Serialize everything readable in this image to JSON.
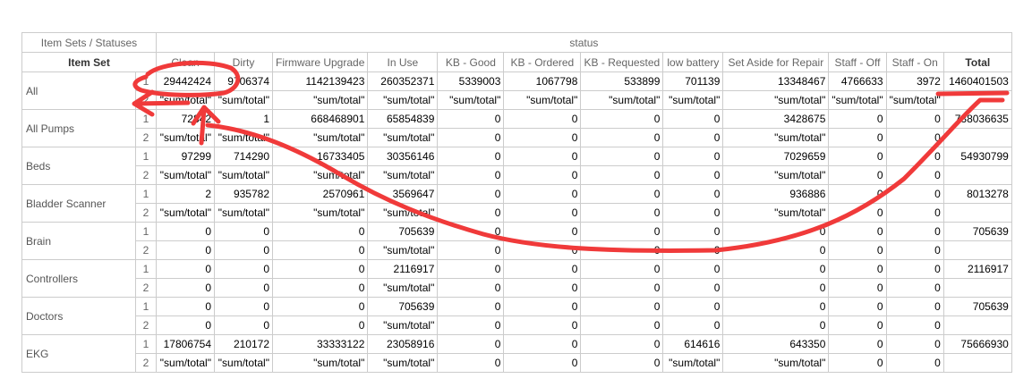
{
  "header": {
    "corner_label": "Item Sets / Statuses",
    "status_group_label": "status",
    "row_header_label": "Item Set",
    "columns": [
      "Clean",
      "Dirty",
      "Firmware Upgrade",
      "In Use",
      "KB - Good",
      "KB - Ordered",
      "KB - Requested",
      "low battery",
      "Set Aside for Repair",
      "Staff - Off",
      "Staff - On",
      "Total"
    ]
  },
  "rows": [
    {
      "name": "All",
      "r1": [
        "29442424",
        "9706374",
        "1142139423",
        "260352371",
        "5339003",
        "1067798",
        "533899",
        "701139",
        "13348467",
        "4766633",
        "3972",
        "1460401503"
      ],
      "r2": [
        "\"sum/total\"",
        "\"sum/total\"",
        "\"sum/total\"",
        "\"sum/total\"",
        "\"sum/total\"",
        "\"sum/total\"",
        "\"sum/total\"",
        "\"sum/total\"",
        "\"sum/total\"",
        "\"sum/total\"",
        "\"sum/total\"",
        ""
      ]
    },
    {
      "name": "All Pumps",
      "r1": [
        "72842",
        "1",
        "668468901",
        "65854839",
        "0",
        "0",
        "0",
        "0",
        "3428675",
        "0",
        "0",
        "738036635"
      ],
      "r2": [
        "\"sum/total\"",
        "\"sum/total\"",
        "\"sum/total\"",
        "\"sum/total\"",
        "0",
        "0",
        "0",
        "0",
        "\"sum/total\"",
        "0",
        "0",
        ""
      ]
    },
    {
      "name": "Beds",
      "r1": [
        "97299",
        "714290",
        "16733405",
        "30356146",
        "0",
        "0",
        "0",
        "0",
        "7029659",
        "0",
        "0",
        "54930799"
      ],
      "r2": [
        "\"sum/total\"",
        "\"sum/total\"",
        "\"sum/total\"",
        "\"sum/total\"",
        "0",
        "0",
        "0",
        "0",
        "\"sum/total\"",
        "0",
        "0",
        ""
      ]
    },
    {
      "name": "Bladder Scanner",
      "r1": [
        "2",
        "935782",
        "2570961",
        "3569647",
        "0",
        "0",
        "0",
        "0",
        "936886",
        "0",
        "0",
        "8013278"
      ],
      "r2": [
        "\"sum/total\"",
        "\"sum/total\"",
        "\"sum/total\"",
        "\"sum/total\"",
        "0",
        "0",
        "0",
        "0",
        "\"sum/total\"",
        "0",
        "0",
        ""
      ]
    },
    {
      "name": "Brain",
      "r1": [
        "0",
        "0",
        "0",
        "705639",
        "0",
        "0",
        "0",
        "0",
        "0",
        "0",
        "0",
        "705639"
      ],
      "r2": [
        "0",
        "0",
        "0",
        "\"sum/total\"",
        "0",
        "0",
        "0",
        "0",
        "0",
        "0",
        "0",
        ""
      ]
    },
    {
      "name": "Controllers",
      "r1": [
        "0",
        "0",
        "0",
        "2116917",
        "0",
        "0",
        "0",
        "0",
        "0",
        "0",
        "0",
        "2116917"
      ],
      "r2": [
        "0",
        "0",
        "0",
        "\"sum/total\"",
        "0",
        "0",
        "0",
        "0",
        "0",
        "0",
        "0",
        ""
      ]
    },
    {
      "name": "Doctors",
      "r1": [
        "0",
        "0",
        "0",
        "705639",
        "0",
        "0",
        "0",
        "0",
        "0",
        "0",
        "0",
        "705639"
      ],
      "r2": [
        "0",
        "0",
        "0",
        "\"sum/total\"",
        "0",
        "0",
        "0",
        "0",
        "0",
        "0",
        "0",
        ""
      ]
    },
    {
      "name": "EKG",
      "r1": [
        "17806754",
        "210172",
        "33333122",
        "23058916",
        "0",
        "0",
        "0",
        "614616",
        "643350",
        "0",
        "0",
        "75666930"
      ],
      "r2": [
        "\"sum/total\"",
        "\"sum/total\"",
        "\"sum/total\"",
        "\"sum/total\"",
        "0",
        "0",
        "0",
        "\"sum/total\"",
        "\"sum/total\"",
        "0",
        "0",
        ""
      ]
    }
  ],
  "row_index_labels": [
    "1",
    "2"
  ],
  "annotation_color": "#f03a3a"
}
